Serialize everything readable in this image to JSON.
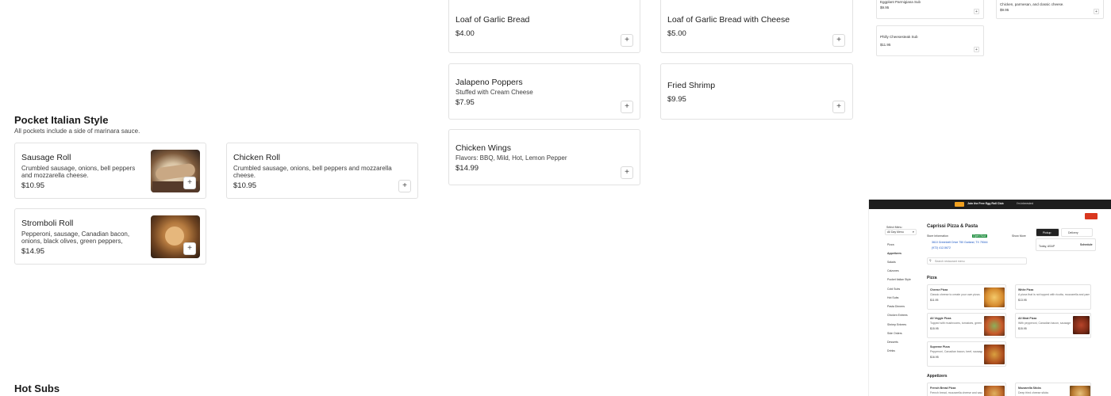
{
  "menu": {
    "appetizer_items": [
      {
        "name": "Loaf of Garlic Bread",
        "description": "",
        "price": "$4.00"
      },
      {
        "name": "Loaf of Garlic Bread with Cheese",
        "description": "",
        "price": "$5.00"
      },
      {
        "name": "Jalapeno Poppers",
        "description": "Stuffed with Cream Cheese",
        "price": "$7.95"
      },
      {
        "name": "Fried Shrimp",
        "description": "",
        "price": "$9.95"
      },
      {
        "name": "Chicken Wings",
        "description": "Flavors: BBQ, Mild, Hot, Lemon Pepper",
        "price": "$14.99"
      }
    ],
    "pocket_section": {
      "title": "Pocket Italian Style",
      "subtitle": "All pockets include a side of marinara sauce.",
      "items": [
        {
          "name": "Sausage Roll",
          "description_line1": "Crumbled sausage, onions, bell peppers",
          "description_line2": "and mozzarella cheese.",
          "price": "$10.95",
          "has_image": true
        },
        {
          "name": "Chicken Roll",
          "description_line1": "Crumbled sausage, onions, bell peppers and mozzarella",
          "description_line2": "cheese.",
          "price": "$10.95",
          "has_image": false
        },
        {
          "name": "Stromboli Roll",
          "description_line1": "Pepperoni, sausage, Canadian bacon,",
          "description_line2": "onions, black olives, green peppers,",
          "price": "$14.95",
          "has_image": true
        }
      ]
    },
    "hot_subs_title": "Hot Subs",
    "add_icon": "plus-icon"
  },
  "mini_top": {
    "items": [
      {
        "name": "Eggplant Parmigiana Sub",
        "price": "$9.95"
      },
      {
        "name": "Chicken, parmesan, and classic cheese.",
        "price": "$9.95"
      },
      {
        "name": "Philly Cheesesteak Sub",
        "price": "$11.95"
      }
    ]
  },
  "embedded": {
    "banner_text": "Join the Free Egg Roll Club",
    "banner_right": "I'm interested",
    "restaurant_name": "Caprissi Pizza & Pasta",
    "menu_select": "All Day Menu",
    "select_menu_label": "Select Menu",
    "store_info": "Store Information",
    "open_badge": "Open Now",
    "address": "3610 Greenbelt Drive 750 Garland, TX 75044",
    "phone": "(972) 412-5672",
    "more_link": "Show More",
    "pickup": "Pickup",
    "delivery": "Delivery",
    "pickup_time": "Today, ASAP",
    "schedule": "Schedule",
    "search_placeholder": "Search restaurant menu",
    "categories": [
      "Pizza",
      "Appetizers",
      "Salads",
      "Calzones",
      "Pocket Italian Style",
      "Cold Subs",
      "Hot Subs",
      "Pasta Dinners",
      "Chicken Entrees",
      "Shrimp Entrees",
      "Side Orders",
      "Desserts",
      "Drinks"
    ],
    "pizza_heading": "Pizza",
    "pizzas": [
      {
        "name": "Cheese Pizza",
        "desc": "Classic cheese to create your own pizza.",
        "price": "$11.95"
      },
      {
        "name": "White Pizza",
        "desc": "A pizza that is not topped with ricotta, mozzarella and parmesan cheese.",
        "price": "$13.95"
      },
      {
        "name": "All Veggie Pizza",
        "desc": "Topped with mushrooms, tomatoes, green peppers",
        "price": "$15.95"
      },
      {
        "name": "All Meat Pizza",
        "desc": "With pepperoni, Canadian bacon, sausage, and ham",
        "price": "$15.95"
      },
      {
        "name": "Supreme Pizza",
        "desc": "Pepperoni, Canadian bacon, beef, sausage, mushrooms, onions",
        "price": "$16.95"
      }
    ],
    "appetizers_heading": "Appetizers",
    "appetizers": [
      {
        "name": "French Bread Pizza",
        "desc": "French bread, mozzarella cheese and sauce"
      },
      {
        "name": "Mozzarella Sticks",
        "desc": "Deep fried cheese sticks"
      }
    ]
  }
}
